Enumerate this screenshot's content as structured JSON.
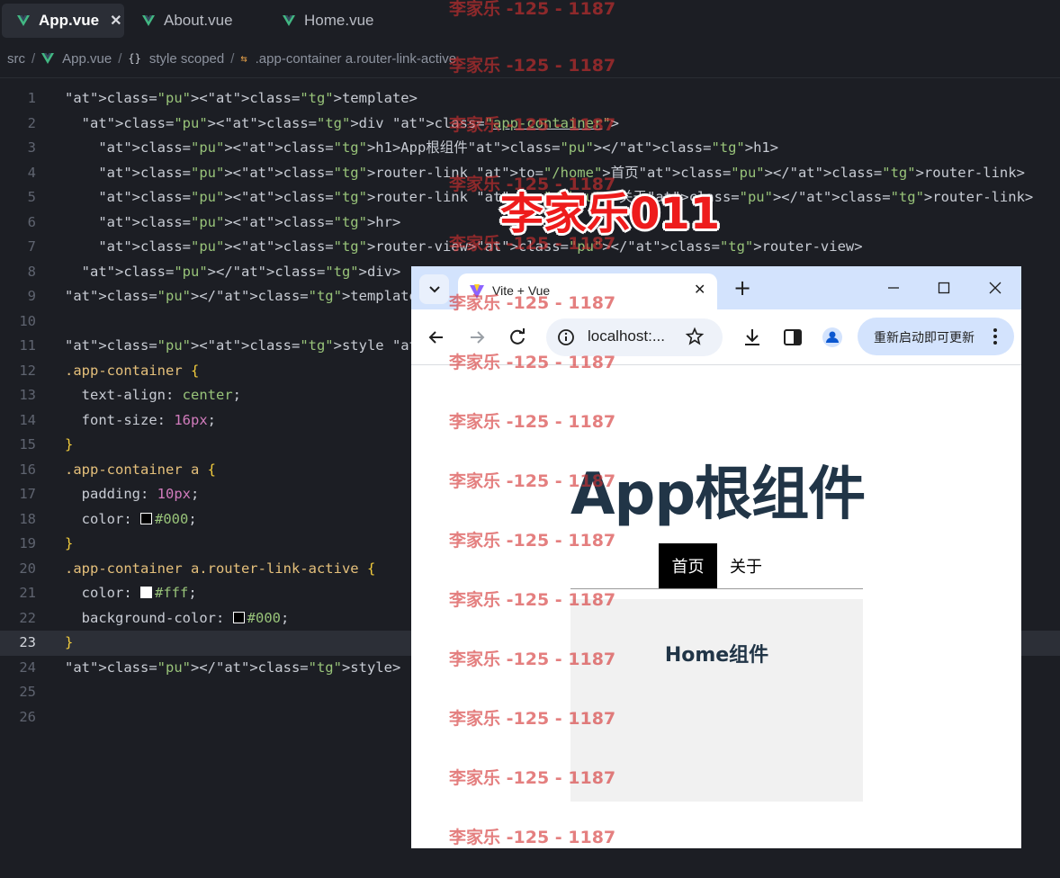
{
  "editor": {
    "tabs": [
      {
        "label": "App.vue",
        "active": true,
        "close": "✕"
      },
      {
        "label": "About.vue",
        "active": false
      },
      {
        "label": "Home.vue",
        "active": false
      }
    ],
    "breadcrumb": [
      "src",
      "App.vue",
      "style scoped",
      ".app-container a.router-link-active"
    ],
    "code_lines": [
      "<template>",
      "  <div class=\"app-container\">",
      "    <h1>App根组件</h1>",
      "    <router-link to=\"/home\">首页</router-link>",
      "    <router-link to=\"/about\">关于</router-link>",
      "    <hr>",
      "    <router-view></router-view>",
      "  </div>",
      "</template>",
      "",
      "<style scoped>",
      ".app-container {",
      "  text-align: center;",
      "  font-size: 16px;",
      "}",
      ".app-container a {",
      "  padding: 10px;",
      "  color: #000;",
      "}",
      ".app-container a.router-link-active {",
      "  color: #fff;",
      "  background-color: #000;",
      "}",
      "</style>",
      "",
      ""
    ],
    "current_line": 23
  },
  "browser": {
    "tab_title": "Vite + Vue",
    "tab_close": "✕",
    "new_tab": "+",
    "url": "localhost:...",
    "update_button": "重新启动即可更新",
    "page": {
      "heading": "App根组件",
      "links": [
        {
          "label": "首页",
          "active": true
        },
        {
          "label": "关于",
          "active": false
        }
      ],
      "view_heading": "Home组件"
    }
  },
  "watermarks": {
    "small": "李家乐 -125 - 1187",
    "big": "李家乐011"
  },
  "colors": {
    "editor_bg": "#1c1e24",
    "vue_green": "#42b883",
    "tag": "#e06c75",
    "string": "#98c379",
    "selector": "#e5c07b",
    "number": "#d27cbd",
    "watermark": "#d43030"
  }
}
